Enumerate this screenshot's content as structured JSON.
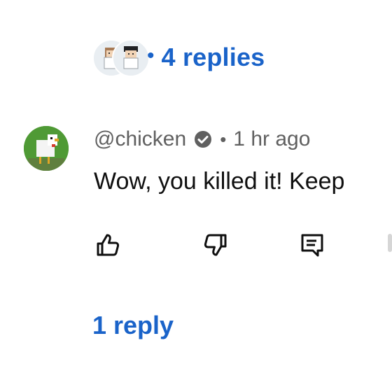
{
  "thread": {
    "replies_separator": "•",
    "replies_label": "4 replies",
    "reply_avatars": [
      "reply-avatar-1",
      "reply-avatar-2"
    ]
  },
  "comment": {
    "handle": "@chicken",
    "meta_separator": "•",
    "time_ago": "1 hr ago",
    "text": "Wow, you killed it! Keep",
    "verified_icon": "verified-check-icon"
  },
  "actions": {
    "like_icon": "thumbs-up-icon",
    "dislike_icon": "thumbs-down-icon",
    "reply_icon": "comment-reply-icon"
  },
  "replies": {
    "label": "1 reply"
  },
  "colors": {
    "link_blue": "#1a63c9",
    "meta_gray": "#606060",
    "text_dark": "#0f0f0f"
  }
}
